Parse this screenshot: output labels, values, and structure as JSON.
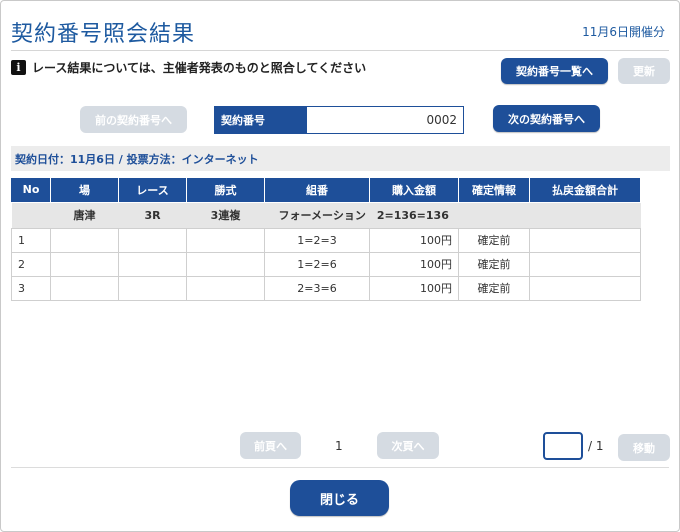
{
  "header": {
    "title": "契約番号照会結果",
    "race_date": "11月6日開催分"
  },
  "notice": {
    "icon": "info-icon",
    "icon_glyph": "i",
    "text": "レース結果については、主催者発表のものと照合してください"
  },
  "top_buttons": {
    "contract_list": "契約番号一覧へ",
    "refresh": "更新"
  },
  "contract_nav": {
    "prev": "前の契約番号へ",
    "label": "契約番号",
    "value": "0002",
    "next": "次の契約番号へ"
  },
  "info_bar": "契約日付：11月6日 / 投票方法：インターネット",
  "table": {
    "headers": [
      "No",
      "場",
      "レース",
      "勝式",
      "組番",
      "購入金額",
      "確定情報",
      "払戻金額合計"
    ],
    "summary": {
      "venue": "唐津",
      "race": "3R",
      "bet_type": "3連複",
      "combination": "フォーメーション　2=136=136"
    },
    "rows": [
      {
        "no": "1",
        "combo": "1=2=3",
        "amount": "100円",
        "status": "確定前"
      },
      {
        "no": "2",
        "combo": "1=2=6",
        "amount": "100円",
        "status": "確定前"
      },
      {
        "no": "3",
        "combo": "2=3=6",
        "amount": "100円",
        "status": "確定前"
      }
    ]
  },
  "pagination": {
    "prev": "前頁へ",
    "current": "1",
    "next": "次頁へ",
    "total": "/ 1",
    "move": "移動",
    "page_input_value": ""
  },
  "footer": {
    "close": "閉じる"
  },
  "colors": {
    "primary": "#1e4f99",
    "title": "#1e5aa0",
    "disabled": "#d5dbe2"
  }
}
